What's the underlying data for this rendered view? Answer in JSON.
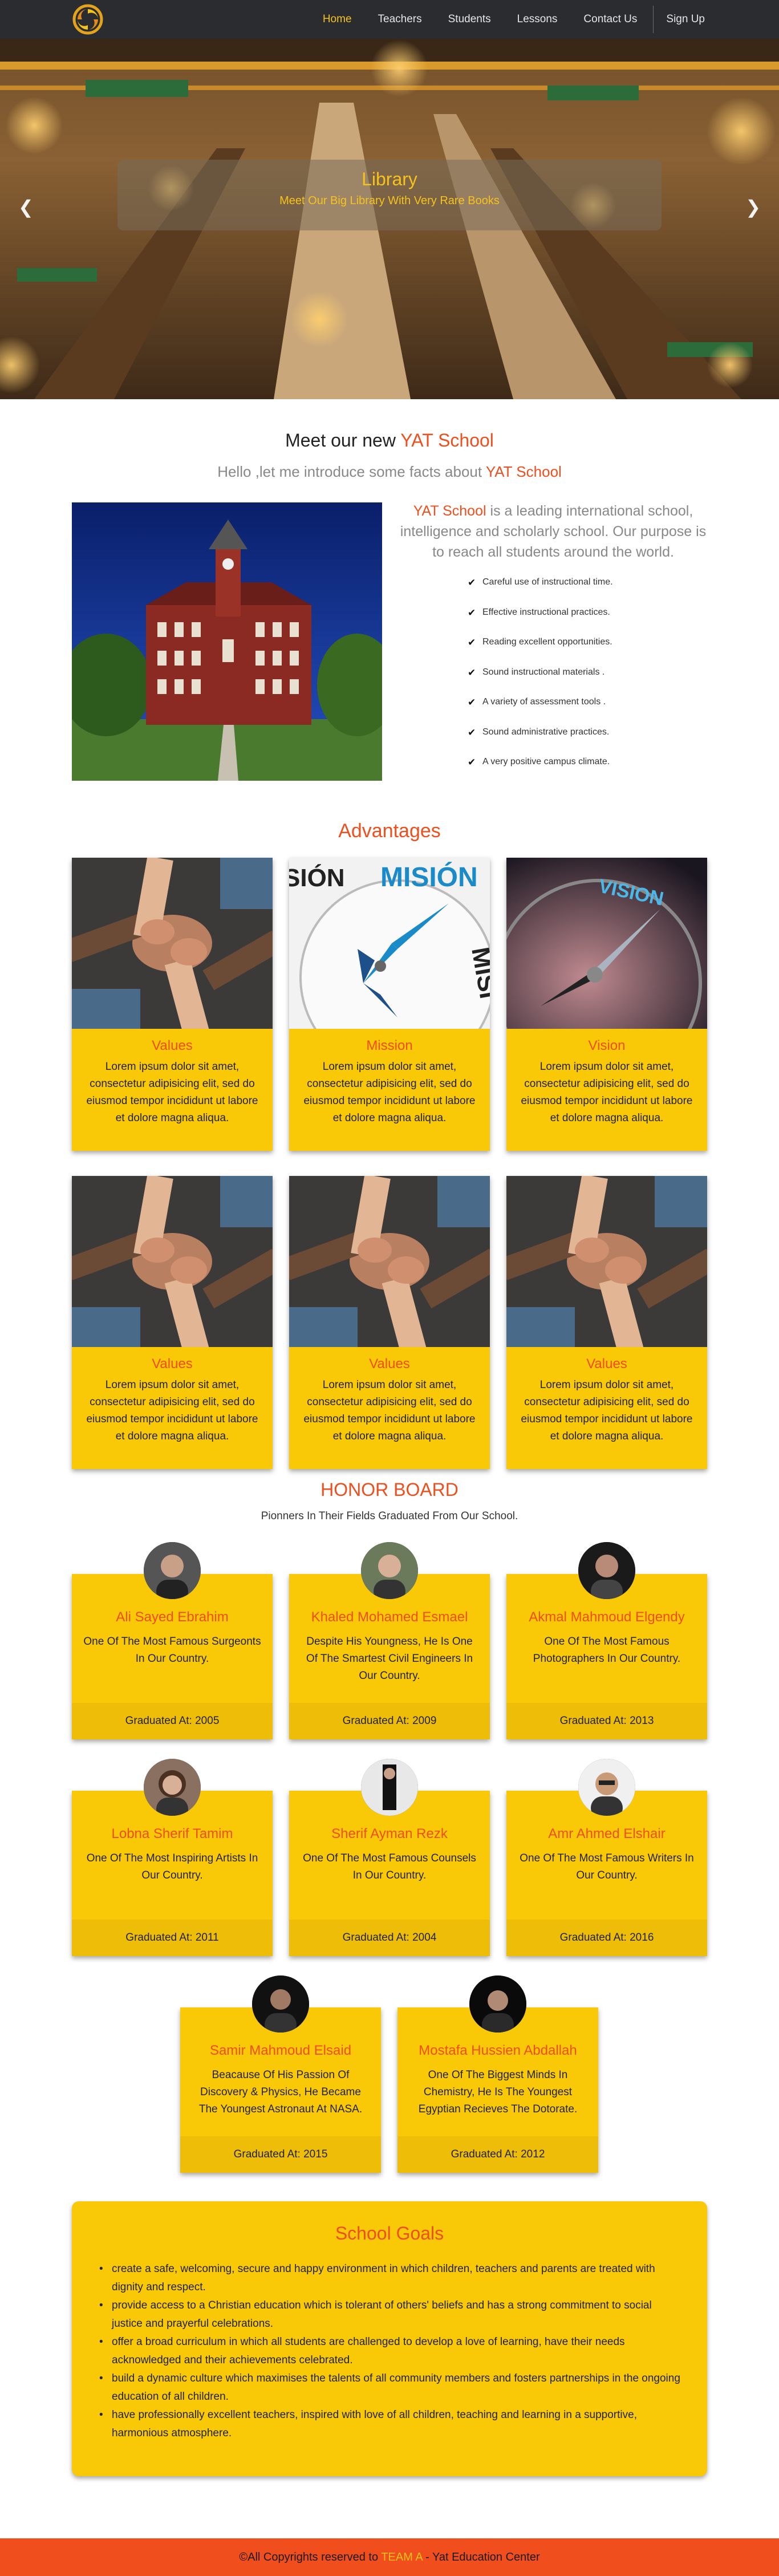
{
  "nav": {
    "links": [
      "Home",
      "Teachers",
      "Students",
      "Lessons",
      "Contact Us"
    ],
    "signup": "Sign Up",
    "accent": "#f6c21c",
    "bg": "#2a2c30"
  },
  "hero": {
    "title": "Library",
    "subtitle": "Meet Our Big Library With Very Rare Books",
    "prev_icon": "chevron-left-icon",
    "next_icon": "chevron-right-icon"
  },
  "meet": {
    "title_prefix": "Meet our new ",
    "title_brand": "YAT School",
    "sub_prefix": "Hello ,let me introduce some facts about ",
    "sub_brand": "YAT School",
    "intro_brand": "YAT School",
    "intro_rest": " is a leading international school, intelligence and scholarly school. Our purpose is to reach all students around the world.",
    "facts": [
      "Careful use of instructional time.",
      "Effective instructional practices.",
      "Reading excellent opportunities.",
      "Sound instructional materials .",
      "A variety of assessment tools .",
      "Sound administrative practices.",
      "A very positive campus climate."
    ]
  },
  "advantages": {
    "title": "Advantages",
    "cards": [
      {
        "title": "Values",
        "text": "Lorem ipsum dolor sit amet, consectetur adipisicing elit, sed do eiusmod tempor incididunt ut labore et dolore magna aliqua."
      },
      {
        "title": "Mission",
        "text": "Lorem ipsum dolor sit amet, consectetur adipisicing elit, sed do eiusmod tempor incididunt ut labore et dolore magna aliqua."
      },
      {
        "title": "Vision",
        "text": "Lorem ipsum dolor sit amet, consectetur adipisicing elit, sed do eiusmod tempor incididunt ut labore et dolore magna aliqua."
      },
      {
        "title": "Values",
        "text": "Lorem ipsum dolor sit amet, consectetur adipisicing elit, sed do eiusmod tempor incididunt ut labore et dolore magna aliqua."
      },
      {
        "title": "Values",
        "text": "Lorem ipsum dolor sit amet, consectetur adipisicing elit, sed do eiusmod tempor incididunt ut labore et dolore magna aliqua."
      },
      {
        "title": "Values",
        "text": "Lorem ipsum dolor sit amet, consectetur adipisicing elit, sed do eiusmod tempor incididunt ut labore et dolore magna aliqua."
      }
    ],
    "compass_words": [
      "SIÓN",
      "MISIÓN",
      "MISI",
      "VISION"
    ]
  },
  "honor": {
    "title": "HONOR BOARD",
    "subtitle": "Pionners In Their Fields Graduated From Our School.",
    "people": [
      {
        "name": "Ali Sayed Ebrahim",
        "desc": "One Of The Most Famous Surgeonts In Our Country.",
        "grad": "Graduated At: 2005"
      },
      {
        "name": "Khaled Mohamed Esmael",
        "desc": "Despite His Youngness, He Is One Of The Smartest Civil Engineers In Our Country.",
        "grad": "Graduated At: 2009"
      },
      {
        "name": "Akmal Mahmoud Elgendy",
        "desc": "One Of The Most Famous Photographers In Our Country.",
        "grad": "Graduated At: 2013"
      },
      {
        "name": "Lobna Sherif Tamim",
        "desc": "One Of The Most Inspiring Artists In Our Country.",
        "grad": "Graduated At: 2011"
      },
      {
        "name": "Sherif Ayman Rezk",
        "desc": "One Of The Most Famous Counsels In Our Country.",
        "grad": "Graduated At: 2004"
      },
      {
        "name": "Amr Ahmed Elshair",
        "desc": "One Of The Most Famous Writers In Our Country.",
        "grad": "Graduated At: 2016"
      },
      {
        "name": "Samir Mahmoud Elsaid",
        "desc": "Beacause Of His Passion Of Discovery & Physics, He Became The Youngest Astronaut At NASA.",
        "grad": "Graduated At: 2015"
      },
      {
        "name": "Mostafa Hussien Abdallah",
        "desc": "One Of The Biggest Minds In Chemistry, He Is The Youngest Egyptian Recieves The Dotorate.",
        "grad": "Graduated At: 2012"
      }
    ]
  },
  "goals": {
    "title": "School Goals",
    "items": [
      "create a safe, welcoming, secure and happy environment in which children, teachers and parents are treated with dignity and respect.",
      "provide access to a Christian education which is tolerant of others' beliefs and has a strong commitment to social justice and prayerful celebrations.",
      "offer a broad curriculum in which all students are challenged to develop a love of learning, have their needs acknowledged and their achievements celebrated.",
      "build a dynamic culture which maximises the talents of all community members and fosters partnerships in the ongoing education of all children.",
      "have professionally excellent teachers, inspired with love of all children, teaching and learning in a supportive, harmonious atmosphere."
    ]
  },
  "footer": {
    "prefix": "©All Copyrights reserved to ",
    "team": "TEAM A",
    "suffix": " - Yat Education Center"
  },
  "colors": {
    "accent_orange": "#f04e1c",
    "card_yellow": "#f9c807",
    "footer_orange": "#f04e1c"
  }
}
